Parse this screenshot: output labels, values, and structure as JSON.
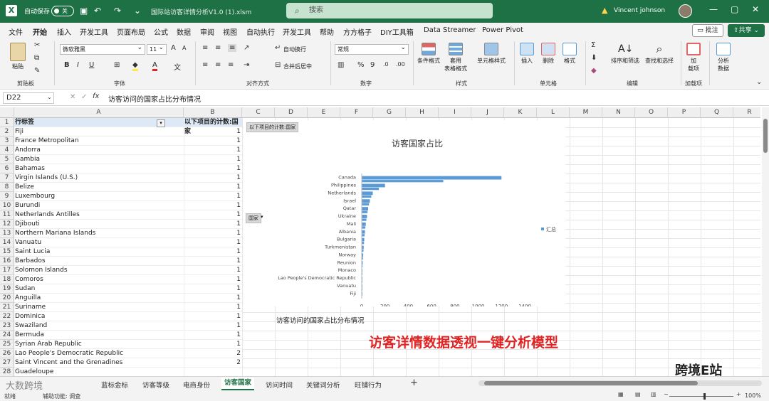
{
  "titlebar": {
    "autosave_label": "自动保存",
    "autosave_state": "关",
    "filename": "国际站访客详情分析V1.0 (1).xlsm",
    "search_placeholder": "搜索",
    "user_name": "Vincent johnson"
  },
  "menu": {
    "items": [
      "文件",
      "开始",
      "插入",
      "开发工具",
      "页面布局",
      "公式",
      "数据",
      "审阅",
      "视图",
      "自动执行",
      "开发工具",
      "帮助",
      "方方格子",
      "DIY工具箱",
      "Data Streamer",
      "Power Pivot"
    ],
    "active_index": 1,
    "comment_label": "批注",
    "share_label": "共享"
  },
  "ribbon": {
    "paste_label": "粘贴",
    "clipboard_label": "剪贴板",
    "font_name": "微软雅黑",
    "font_size": "11",
    "font_group_label": "字体",
    "wrap_label": "自动换行",
    "merge_label": "合并后居中",
    "align_group_label": "对齐方式",
    "number_format": "常规",
    "number_group_label": "数字",
    "cond_format_label": "条件格式",
    "table_format_label_1": "套用",
    "table_format_label_2": "表格格式",
    "cell_style_label": "单元格样式",
    "style_group_label": "样式",
    "insert_label": "插入",
    "delete_label": "删除",
    "format_label": "格式",
    "cells_group_label": "单元格",
    "sort_label": "排序和筛选",
    "find_label": "查找和选择",
    "edit_group_label": "编辑",
    "addin_label_1": "加",
    "addin_label_2": "载项",
    "addin_group_label": "加载项",
    "analyze_label_1": "分析",
    "analyze_label_2": "数据"
  },
  "formula_bar": {
    "cell_ref": "D22",
    "fx": "fx",
    "content": "访客访问的国家占比分布情况"
  },
  "columns": [
    "A",
    "B",
    "C",
    "D",
    "E",
    "F",
    "G",
    "H",
    "I",
    "J",
    "K",
    "L",
    "M",
    "N",
    "O",
    "P",
    "Q",
    "R"
  ],
  "pivot": {
    "header_a": "行标签",
    "header_b": "以下项目的计数:国家",
    "rows": [
      {
        "label": "Fiji",
        "count": "1"
      },
      {
        "label": "France Metropolitan",
        "count": "1"
      },
      {
        "label": "Andorra",
        "count": "1"
      },
      {
        "label": "Gambia",
        "count": "1"
      },
      {
        "label": "Bahamas",
        "count": "1"
      },
      {
        "label": "Virgin Islands (U.S.)",
        "count": "1"
      },
      {
        "label": "Belize",
        "count": "1"
      },
      {
        "label": "Luxembourg",
        "count": "1"
      },
      {
        "label": "Burundi",
        "count": "1"
      },
      {
        "label": "Netherlands Antilles",
        "count": "1"
      },
      {
        "label": "Djibouti",
        "count": "1"
      },
      {
        "label": "Northern Mariana Islands",
        "count": "1"
      },
      {
        "label": "Vanuatu",
        "count": "1"
      },
      {
        "label": "Saint Lucia",
        "count": "1"
      },
      {
        "label": "Barbados",
        "count": "1"
      },
      {
        "label": "Solomon Islands",
        "count": "1"
      },
      {
        "label": "Comoros",
        "count": "1"
      },
      {
        "label": "Sudan",
        "count": "1"
      },
      {
        "label": "Anguilla",
        "count": "1"
      },
      {
        "label": "Suriname",
        "count": "1"
      },
      {
        "label": "Dominica",
        "count": "1"
      },
      {
        "label": "Swaziland",
        "count": "1"
      },
      {
        "label": "Bermuda",
        "count": "1"
      },
      {
        "label": "Syrian Arab Republic",
        "count": "1"
      },
      {
        "label": "Lao People's Democratic Republic",
        "count": "2"
      },
      {
        "label": "Saint Vincent and the Grenadines",
        "count": "2"
      },
      {
        "label": "Guadeloupe",
        "count": ""
      }
    ]
  },
  "chart": {
    "field_button": "以下项目的计数:国家",
    "axis_field_button": "国家",
    "legend_label": "汇总"
  },
  "chart_data": {
    "type": "bar",
    "title": "访客国家占比",
    "orientation": "horizontal",
    "categories": [
      "Canada",
      "Philippines",
      "Netherlands",
      "Israel",
      "Qatar",
      "Ukraine",
      "Mali",
      "Albania",
      "Bulgaria",
      "Turkmenistan",
      "Norway",
      "Reunion",
      "Monaco",
      "Lao People's Democratic Republic",
      "Vanuatu",
      "Fiji"
    ],
    "series": [
      {
        "name": "汇总",
        "values": [
          1200,
          200,
          95,
          70,
          55,
          45,
          35,
          28,
          22,
          17,
          13,
          9,
          6,
          2,
          1,
          1
        ]
      }
    ],
    "xlim": [
      0,
      1400
    ],
    "xticks": [
      "0",
      "200",
      "400",
      "600",
      "800",
      "1000",
      "1200",
      "1400"
    ],
    "legend_position": "right"
  },
  "sheet_text": {
    "caption": "访客访问的国家占比分布情况",
    "red_title": "访客详情数据透视一键分析模型",
    "watermark_right": "跨境E站",
    "watermark_left": "大数跨境"
  },
  "tabs": {
    "items": [
      "蓝标金标",
      "访客等级",
      "电商身份",
      "访客国家",
      "访问时间",
      "关键词分析",
      "旺铺行为"
    ],
    "active_index": 3,
    "add": "+"
  },
  "status": {
    "ready": "就绪",
    "accessibility": "辅助功能: 调查",
    "zoom": "100%"
  },
  "colors": {
    "excel_green": "#1e7145",
    "bar": "#5b9bd5",
    "red_title": "#e02424"
  }
}
